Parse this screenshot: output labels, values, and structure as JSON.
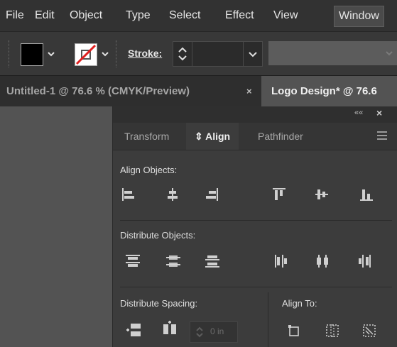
{
  "menu": {
    "file": "File",
    "edit": "Edit",
    "object": "Object",
    "type": "Type",
    "select": "Select",
    "effect": "Effect",
    "view": "View",
    "window": "Window"
  },
  "controlbar": {
    "stroke_label": "Stroke:",
    "fill_color": "#000000",
    "stroke_color": "none"
  },
  "tabs": {
    "doc1": "Untitled-1 @ 76.6 % (CMYK/Preview)",
    "doc1_close": "×",
    "doc2": "Logo Design* @ 76.6"
  },
  "panel": {
    "collapse_glyph": "««",
    "close_glyph": "×",
    "tab_transform": "Transform",
    "tab_align": "Align",
    "tab_align_glyph": "⇕",
    "tab_pathfinder": "Pathfinder",
    "align_objects": "Align Objects:",
    "distribute_objects": "Distribute Objects:",
    "distribute_spacing": "Distribute Spacing:",
    "align_to": "Align To:",
    "spacing_value": "0 in"
  },
  "icons": {
    "align_objects": [
      "align-left-icon",
      "align-horizontal-center-icon",
      "align-right-icon",
      "align-top-icon",
      "align-vertical-center-icon",
      "align-bottom-icon"
    ],
    "distribute_objects": [
      "distribute-top-icon",
      "distribute-vertical-center-icon",
      "distribute-bottom-icon",
      "distribute-left-icon",
      "distribute-horizontal-center-icon",
      "distribute-right-icon"
    ],
    "distribute_spacing": [
      "vertical-spacing-icon",
      "horizontal-spacing-icon"
    ],
    "align_to": [
      "align-to-selection-icon",
      "align-to-key-object-icon",
      "align-to-artboard-icon"
    ]
  },
  "colors": {
    "menubar": "#323232",
    "panel": "#3c3c3c",
    "canvas": "#535353",
    "icon": "#cfcfcf",
    "stroke_none": "#e02020"
  }
}
